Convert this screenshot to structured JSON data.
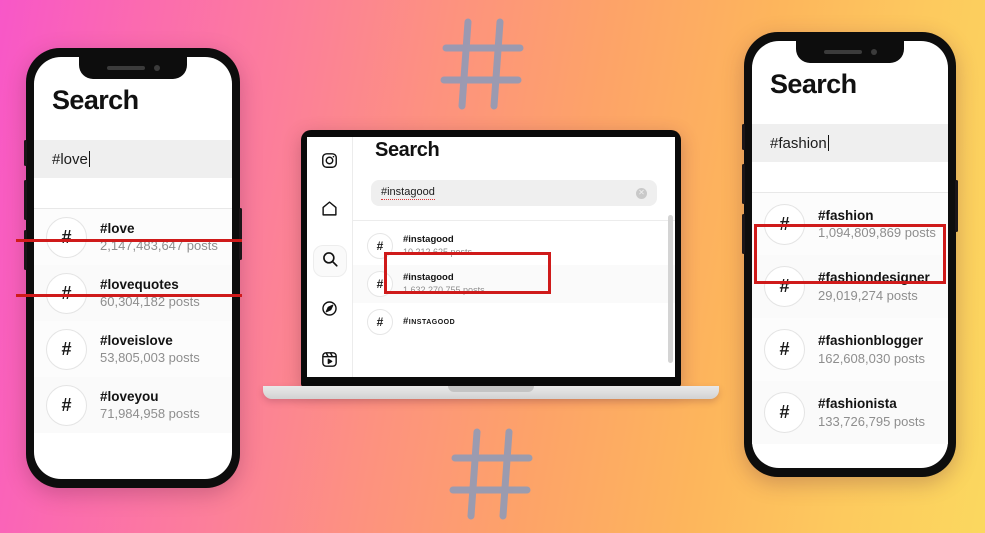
{
  "background": {
    "gradient_from": "#f857c8",
    "gradient_mid": "#fd9a72",
    "gradient_to": "#fbd85f"
  },
  "decorations": {
    "hashtag_color": "#8b9bbb",
    "hashtag_top_label": "hashtag-symbol",
    "hashtag_bottom_label": "hashtag-symbol"
  },
  "highlight_color": "#cf1a1a",
  "phone_left": {
    "app_title": "Search",
    "search_value": "#love",
    "results": [
      {
        "tag": "#love",
        "count": "2,147,483,647 posts",
        "highlighted": true
      },
      {
        "tag": "#lovequotes",
        "count": "60,304,182 posts",
        "highlighted": false
      },
      {
        "tag": "#loveislove",
        "count": "53,805,003 posts",
        "highlighted": false
      },
      {
        "tag": "#loveyou",
        "count": "71,984,958 posts",
        "highlighted": false
      }
    ]
  },
  "phone_right": {
    "app_title": "Search",
    "search_value": "#fashion",
    "results": [
      {
        "tag": "#fashion",
        "count": "1,094,809,869 posts",
        "highlighted": true
      },
      {
        "tag": "#fashiondesigner",
        "count": "29,019,274 posts",
        "highlighted": false
      },
      {
        "tag": "#fashionblogger",
        "count": "162,608,030 posts",
        "highlighted": false
      },
      {
        "tag": "#fashionista",
        "count": "133,726,795 posts",
        "highlighted": false
      }
    ]
  },
  "laptop": {
    "app_title": "Search",
    "search_value": "#instagood",
    "clear_glyph": "✕",
    "sidebar": [
      {
        "name": "instagram-logo-icon",
        "label": "Instagram"
      },
      {
        "name": "home-icon",
        "label": "Home"
      },
      {
        "name": "search-icon",
        "label": "Search"
      },
      {
        "name": "explore-icon",
        "label": "Explore"
      },
      {
        "name": "reels-icon",
        "label": "Reels"
      }
    ],
    "active_sidebar_item": "search-icon",
    "results": [
      {
        "tag": "#instagood",
        "count": "10.212.625 posts",
        "highlighted": true,
        "smallcaps": false
      },
      {
        "tag": "#instagood",
        "count": "1.632.270.755 posts",
        "highlighted": false,
        "smallcaps": false
      },
      {
        "tag": "#instagood",
        "count": "",
        "highlighted": false,
        "smallcaps": true
      }
    ]
  }
}
